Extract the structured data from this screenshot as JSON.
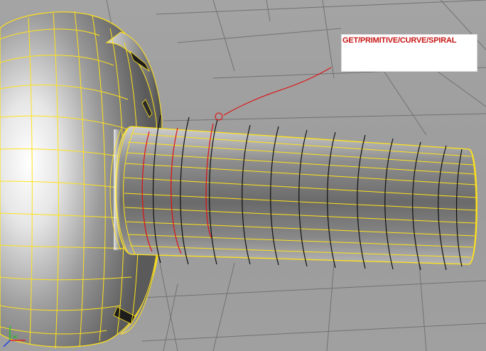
{
  "viewport": {
    "annotation": {
      "text": "GET/PRIMITIVE/CURVE/SPIRAL",
      "color": "#c81414"
    },
    "colors": {
      "wireframe": "#ffe21a",
      "spiral": "#111111",
      "spiral_selected": "#e01010",
      "leader": "#e01010",
      "grid": "#6e6e6e"
    },
    "axis_gizmo": {
      "x_color": "#e02020",
      "y_color": "#20c020",
      "z_color": "#2040e0"
    }
  }
}
